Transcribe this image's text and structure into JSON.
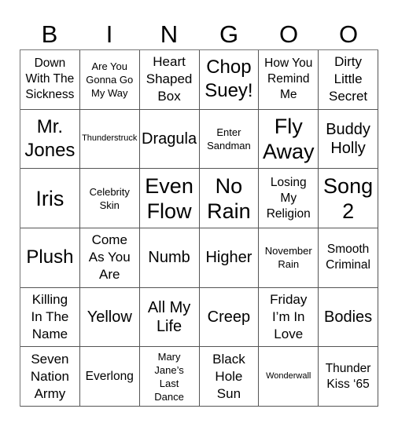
{
  "header": {
    "letters": [
      "B",
      "I",
      "N",
      "G",
      "O",
      "O"
    ]
  },
  "cells": [
    [
      "Down\nWith The\nSickness",
      "Are You\nGonna Go\nMy Way",
      "Heart\nShaped\nBox",
      "Chop\nSuey!",
      "How You\nRemind\nMe",
      "Dirty\nLittle\nSecret"
    ],
    [
      "Mr.\nJones",
      "Thunderstruck",
      "Dragula",
      "Enter\nSandman",
      "Fly\nAway",
      "Buddy\nHolly"
    ],
    [
      "Iris",
      "Celebrity\nSkin",
      "Even\nFlow",
      "No\nRain",
      "Losing\nMy\nReligion",
      "Song\n2"
    ],
    [
      "Plush",
      "Come\nAs You\nAre",
      "Numb",
      "Higher",
      "November\nRain",
      "Smooth\nCriminal"
    ],
    [
      "Killing\nIn The\nName",
      "Yellow",
      "All My\nLife",
      "Creep",
      "Friday\nI’m In\nLove",
      "Bodies"
    ],
    [
      "Seven\nNation\nArmy",
      "Everlong",
      "Mary\nJane’s\nLast\nDance",
      "Black\nHole\nSun",
      "Wonderwall",
      "Thunder\nKiss ‘65"
    ]
  ]
}
